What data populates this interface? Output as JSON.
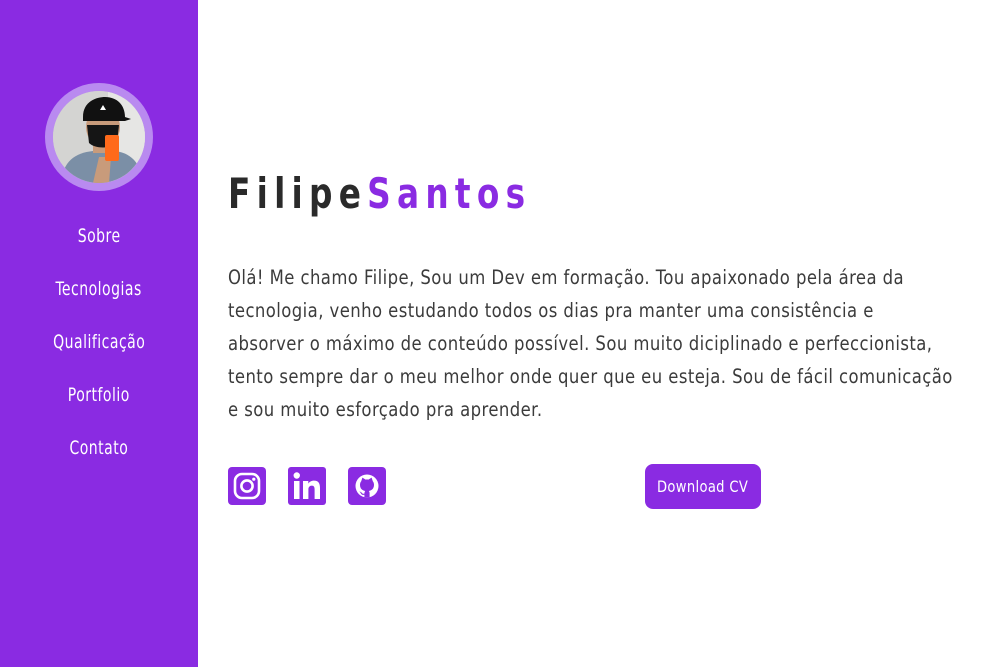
{
  "sidebar": {
    "avatar_alt": "Filipe Santos",
    "nav": [
      {
        "label": "Sobre"
      },
      {
        "label": "Tecnologias"
      },
      {
        "label": "Qualificação"
      },
      {
        "label": "Portfolio"
      },
      {
        "label": "Contato"
      }
    ]
  },
  "hero": {
    "first_name": "Filipe",
    "last_name": "Santos",
    "about": "Olá! Me chamo Filipe, Sou um Dev em formação. Tou apaixonado pela área da tecnologia, venho estudando todos os dias pra manter uma consistência e absorver o máximo de conteúdo possível. Sou muito diciplinado e perfeccionista, tento sempre dar o meu melhor onde quer que eu esteja. Sou de fácil comunicação e sou muito esforçado pra aprender.",
    "socials": [
      {
        "icon": "instagram-icon"
      },
      {
        "icon": "linkedin-icon"
      },
      {
        "icon": "github-icon"
      }
    ],
    "download_label": "Download CV"
  },
  "colors": {
    "accent": "#8a2be2",
    "text_dark": "#2a2a2a",
    "text_body": "#3b3b3b",
    "background": "#ffffff"
  }
}
